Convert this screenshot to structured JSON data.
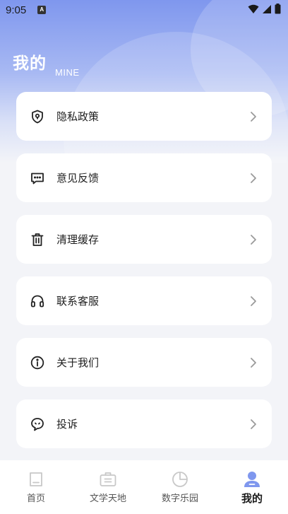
{
  "status_bar": {
    "time": "9:05",
    "notification_badge": "A",
    "icons": [
      "wifi-icon",
      "signal-icon",
      "battery-icon"
    ]
  },
  "header": {
    "title": "我的",
    "subtitle": "MINE",
    "gradient_colors": [
      "#7f97ee",
      "#d9e0f7"
    ]
  },
  "menu": {
    "items": [
      {
        "label": "隐私政策",
        "icon": "privacy-shield-icon"
      },
      {
        "label": "意见反馈",
        "icon": "feedback-chat-icon"
      },
      {
        "label": "清理缓存",
        "icon": "trash-icon"
      },
      {
        "label": "联系客服",
        "icon": "headset-icon"
      },
      {
        "label": "关于我们",
        "icon": "info-icon"
      },
      {
        "label": "投诉",
        "icon": "complaint-chat-icon"
      }
    ]
  },
  "tabbar": {
    "tabs": [
      {
        "label": "首页",
        "icon": "home-icon",
        "active": false
      },
      {
        "label": "文学天地",
        "icon": "briefcase-icon",
        "active": false
      },
      {
        "label": "数字乐园",
        "icon": "pie-chart-icon",
        "active": false
      },
      {
        "label": "我的",
        "icon": "user-icon",
        "active": true
      }
    ],
    "active_color": "#7f97ee",
    "inactive_color": "#c8c8c8"
  }
}
